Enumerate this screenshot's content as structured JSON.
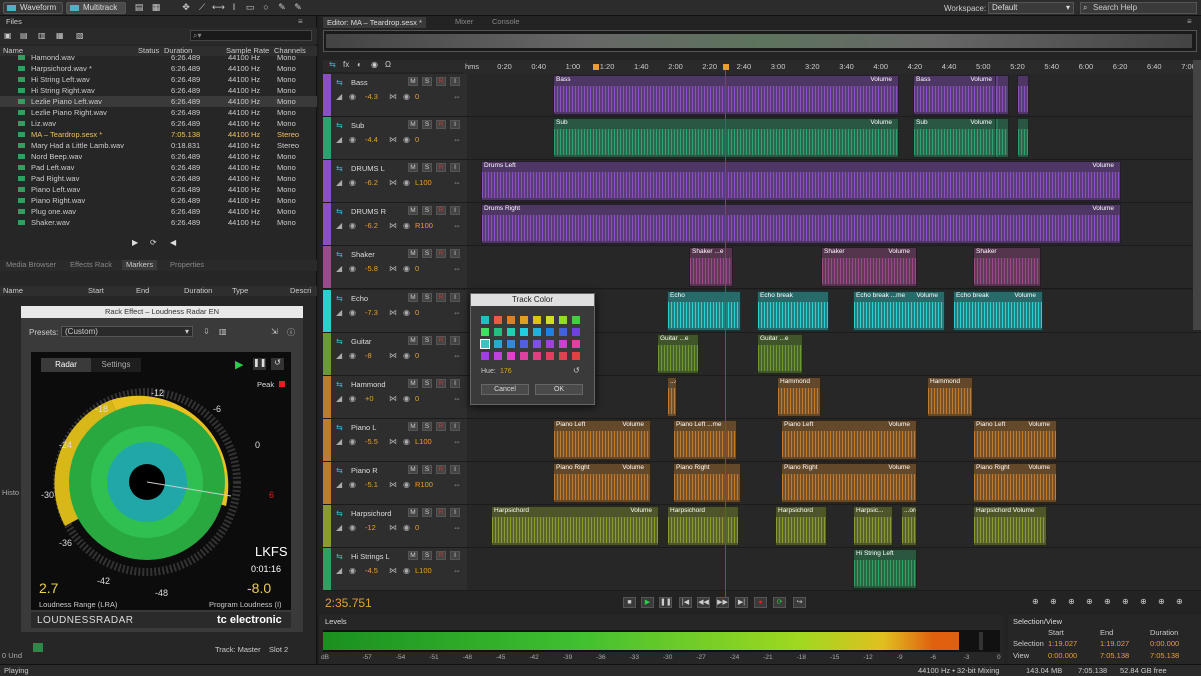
{
  "topbar": {
    "waveform_label": "Waveform",
    "multitrack_label": "Multitrack",
    "workspace_label": "Workspace:",
    "workspace_value": "Default",
    "search_placeholder": "Search Help"
  },
  "files": {
    "title": "Files",
    "columns": [
      "Name",
      "Status",
      "Duration",
      "Sample Rate",
      "Channels"
    ],
    "rows": [
      {
        "name": "Hamond.wav",
        "duration": "6:26.489",
        "rate": "44100 Hz",
        "ch": "Mono"
      },
      {
        "name": "Harpsichord.wav *",
        "duration": "6:26.489",
        "rate": "44100 Hz",
        "ch": "Mono"
      },
      {
        "name": "Hi String Left.wav",
        "duration": "6:26.489",
        "rate": "44100 Hz",
        "ch": "Mono"
      },
      {
        "name": "Hi String Right.wav",
        "duration": "6:26.489",
        "rate": "44100 Hz",
        "ch": "Mono"
      },
      {
        "name": "Lezlie Piano Left.wav",
        "duration": "6:26.489",
        "rate": "44100 Hz",
        "ch": "Mono"
      },
      {
        "name": "Lezlie Piano Right.wav",
        "duration": "6:26.489",
        "rate": "44100 Hz",
        "ch": "Mono"
      },
      {
        "name": "Liz.wav",
        "duration": "6:26.489",
        "rate": "44100 Hz",
        "ch": "Mono"
      },
      {
        "name": "MA – Teardrop.sesx *",
        "duration": "7:05.138",
        "rate": "44100 Hz",
        "ch": "Stereo"
      },
      {
        "name": "Mary Had a Little Lamb.wav",
        "duration": "0:18.831",
        "rate": "44100 Hz",
        "ch": "Stereo"
      },
      {
        "name": "Nord Beep.wav",
        "duration": "6:26.489",
        "rate": "44100 Hz",
        "ch": "Mono"
      },
      {
        "name": "Pad Left.wav",
        "duration": "6:26.489",
        "rate": "44100 Hz",
        "ch": "Mono"
      },
      {
        "name": "Pad Right.wav",
        "duration": "6:26.489",
        "rate": "44100 Hz",
        "ch": "Mono"
      },
      {
        "name": "Piano Left.wav",
        "duration": "6:26.489",
        "rate": "44100 Hz",
        "ch": "Mono"
      },
      {
        "name": "Piano Right.wav",
        "duration": "6:26.489",
        "rate": "44100 Hz",
        "ch": "Mono"
      },
      {
        "name": "Plug one.wav",
        "duration": "6:26.489",
        "rate": "44100 Hz",
        "ch": "Mono"
      },
      {
        "name": "Shaker.wav",
        "duration": "6:26.489",
        "rate": "44100 Hz",
        "ch": "Mono"
      }
    ]
  },
  "lower_tabs": [
    "Media Browser",
    "Effects Rack",
    "Markers",
    "Properties"
  ],
  "markers_columns": [
    "Name",
    "Start",
    "End",
    "Duration",
    "Type",
    "Descri"
  ],
  "history_label": "Histo",
  "undo_label": "0 Und",
  "rack": {
    "title": "Rack Effect – Loudness Radar EN",
    "presets_label": "Presets:",
    "presets_value": "(Custom)",
    "tab_radar": "Radar",
    "tab_settings": "Settings",
    "peak": "Peak",
    "scale": [
      "-12",
      "-6",
      "0",
      "6",
      "-18",
      "-24",
      "-30",
      "-36",
      "-42",
      "-48"
    ],
    "lkfs": "LKFS",
    "time": "0:01:16",
    "lra_value": "2.7",
    "lra_label": "Loudness Range (LRA)",
    "program_value": "-8.0",
    "program_label": "Program Loudness (I)",
    "brand_left": "LOUDNESSRADAR",
    "brand_right": "tc electronic",
    "track_label": "Track: Master",
    "slot_label": "Slot 2"
  },
  "editor": {
    "tab": "Editor: MA – Teardrop.sesx *",
    "mixer": "Mixer",
    "console": "Console",
    "timecode": "2:35.751",
    "ruler": [
      "hms",
      "0:20",
      "0:40",
      "1:00",
      "1:20",
      "1:40",
      "2:00",
      "2:20",
      "2:40",
      "3:00",
      "3:20",
      "3:40",
      "4:00",
      "4:20",
      "4:40",
      "5:00",
      "5:20",
      "5:40",
      "6:00",
      "6:20",
      "6:40",
      "7:00"
    ]
  },
  "tracks": [
    {
      "name": "Bass",
      "vol": "-4.3",
      "pan": "0",
      "color": "#8a4fc0"
    },
    {
      "name": "Sub",
      "vol": "-4.4",
      "pan": "0",
      "color": "#2fa070"
    },
    {
      "name": "DRUMS L",
      "vol": "-6.2",
      "pan": "L100",
      "color": "#8a4fc0"
    },
    {
      "name": "DRUMS R",
      "vol": "-6.2",
      "pan": "R100",
      "color": "#8a4fc0"
    },
    {
      "name": "Shaker",
      "vol": "-5.8",
      "pan": "0",
      "color": "#9a4a8a"
    },
    {
      "name": "Echo",
      "vol": "-7.3",
      "pan": "0",
      "color": "#2ad0d0"
    },
    {
      "name": "Guitar",
      "vol": "-8",
      "pan": "0",
      "color": "#6a9a30"
    },
    {
      "name": "Hammond",
      "vol": "+0",
      "pan": "0",
      "color": "#c07a30"
    },
    {
      "name": "Piano L",
      "vol": "-5.5",
      "pan": "L100",
      "color": "#c07a30"
    },
    {
      "name": "Piano R",
      "vol": "-5.1",
      "pan": "R100",
      "color": "#c07a30"
    },
    {
      "name": "Harpsichord",
      "vol": "-12",
      "pan": "0",
      "color": "#8a9a30"
    },
    {
      "name": "Hi Strings L",
      "vol": "-4.5",
      "pan": "L100",
      "color": "#2fa060"
    }
  ],
  "clip_labels": {
    "bass": "Bass",
    "sub": "Sub",
    "drums_l": "Drums Left",
    "drums_r": "Drums Right",
    "shaker": "Shaker",
    "shaker_e": "Shaker ...e",
    "echo": "Echo",
    "echo_break": "Echo break",
    "echo_break_me": "Echo break ...me",
    "guitar": "Guitar",
    "guitar_e": "Guitar ...e",
    "hammond": "Hammond",
    "d": "...d",
    "piano_left": "Piano Left",
    "piano_left_me": "Piano Left ...me",
    "piano_right": "Piano Right",
    "harpsichord": "Harpsichord",
    "harps_e": "Harpsic...",
    "ord": "...ord",
    "harps_vol": "Harpsichord Volume",
    "hi_string": "Hi String Left",
    "volume": "Volume"
  },
  "dialog": {
    "title": "Track Color",
    "hue_label": "Hue:",
    "hue_value": "176",
    "cancel": "Cancel",
    "ok": "OK"
  },
  "levels": {
    "title": "Levels",
    "scale": [
      "dB",
      "-57",
      "-54",
      "-51",
      "-48",
      "-45",
      "-42",
      "-39",
      "-36",
      "-33",
      "-30",
      "-27",
      "-24",
      "-21",
      "-18",
      "-15",
      "-12",
      "-9",
      "-6",
      "-3",
      "0"
    ],
    "fill_fraction": 0.94
  },
  "selview": {
    "title": "Selection/View",
    "start": "Start",
    "end": "End",
    "duration": "Duration",
    "sel": "Selection",
    "view": "View",
    "sel_start": "1:19.027",
    "sel_end": "1:19.027",
    "sel_dur": "0:00.000",
    "view_start": "0:00.000",
    "view_end": "7:05.138",
    "view_dur": "7:05.138"
  },
  "status": {
    "left": "Playing",
    "rate": "44100 Hz • 32-bit Mixing",
    "mem": "143.04 MB",
    "dur": "7:05.138",
    "free": "52.84 GB free"
  }
}
